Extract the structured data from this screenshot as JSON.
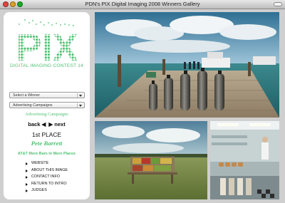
{
  "window": {
    "title": "PDN's PIX Digital Imaging 2008 Winners Gallery"
  },
  "sidebar": {
    "logo_text": "PIX",
    "contest_label": "DIGITAL IMAGING CONTEST 14",
    "winner_select": {
      "value": "Select a Winner"
    },
    "category_select": {
      "value": "Advertising Campaigns"
    },
    "category_title": "Advertising Campaigns",
    "nav": {
      "back_label": "back",
      "next_label": "next"
    },
    "place_label": "1st PLACE",
    "winner_name": "Pete Barrett",
    "tagline": "AT&T More Bars in More Places",
    "menu": [
      {
        "label": "WEBSITE"
      },
      {
        "label": "ABOUT THIS IMAGE"
      },
      {
        "label": "CONTACT INFO"
      },
      {
        "label": "RETURN TO INTRO"
      },
      {
        "label": "JUDGES"
      }
    ]
  },
  "colors": {
    "accent_green": "#4fc273",
    "sidebar_bg": "#ffffff",
    "window_bg": "#cfcfcf"
  },
  "icons": {
    "nav_back": "triangle-left-icon",
    "nav_next": "triangle-right-icon",
    "menu_bullet": "triangle-right-icon"
  }
}
